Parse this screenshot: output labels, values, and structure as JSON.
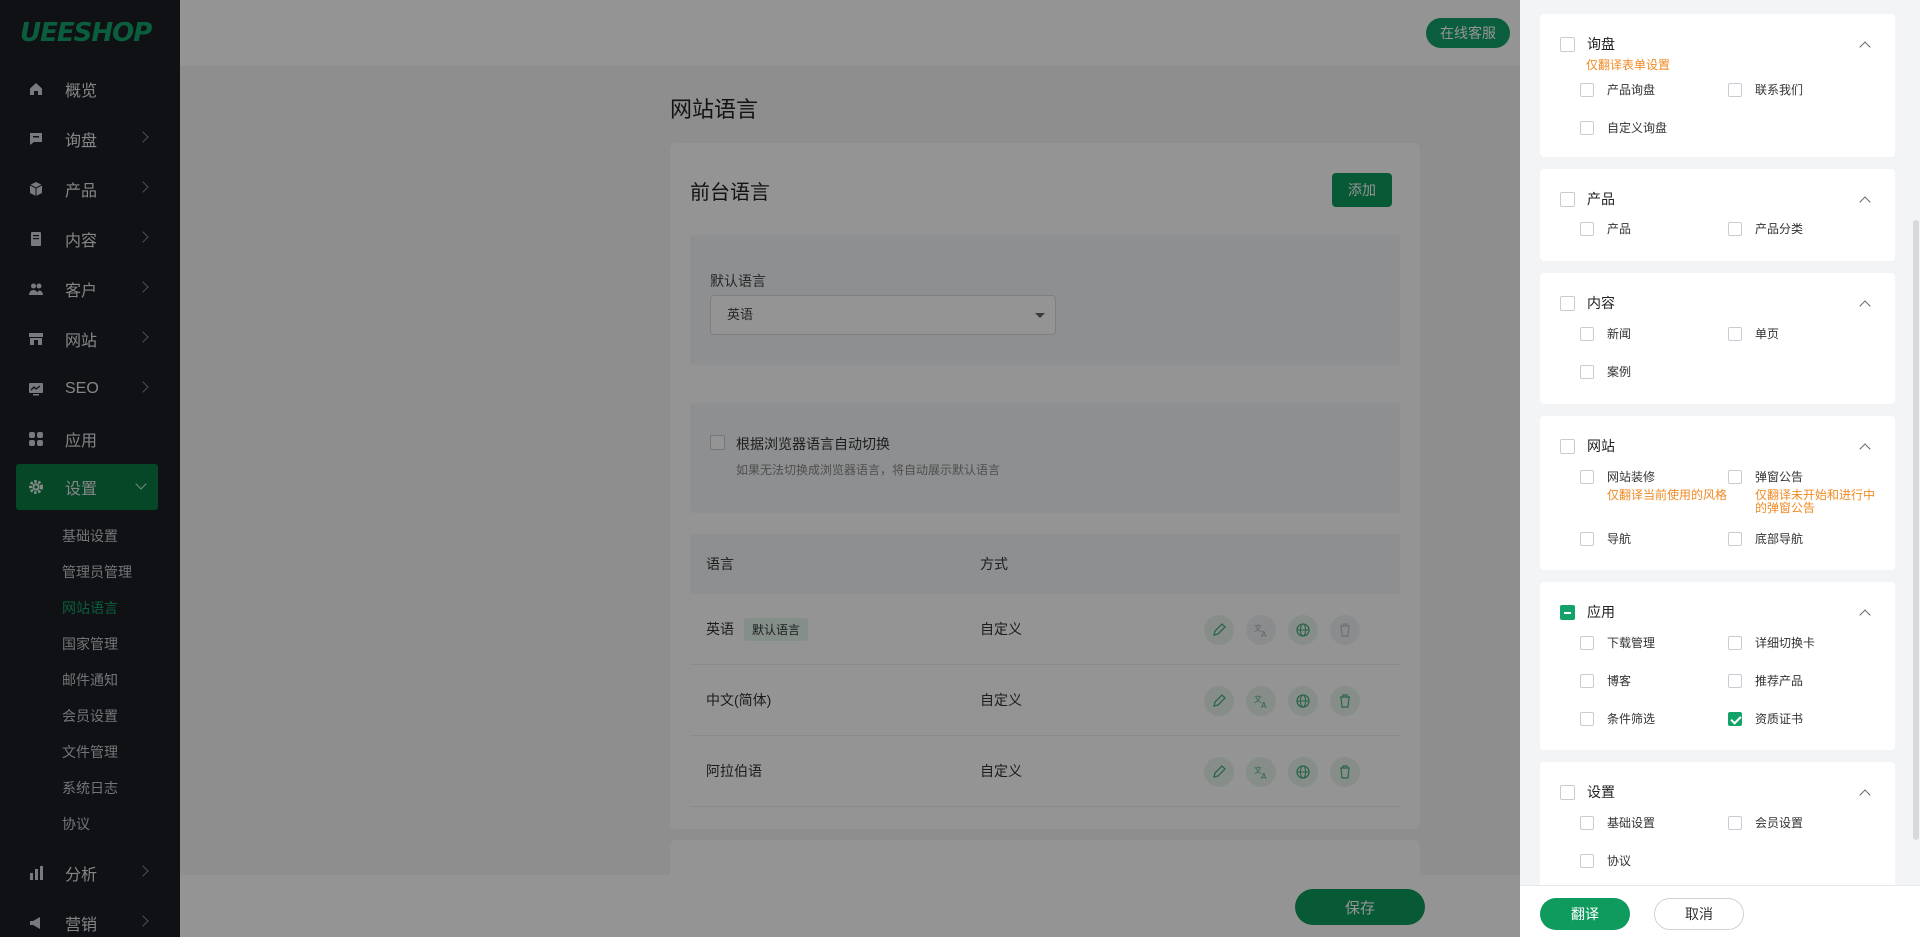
{
  "brand": {
    "logo_text": "UEESHOP"
  },
  "sidebar": {
    "items": [
      {
        "label": "概览",
        "icon": "home-icon"
      },
      {
        "label": "询盘",
        "icon": "message-icon"
      },
      {
        "label": "产品",
        "icon": "box-icon"
      },
      {
        "label": "内容",
        "icon": "document-icon"
      },
      {
        "label": "客户",
        "icon": "users-icon"
      },
      {
        "label": "网站",
        "icon": "store-icon"
      },
      {
        "label": "SEO",
        "icon": "monitor-icon"
      },
      {
        "label": "应用",
        "icon": "apps-icon"
      },
      {
        "label": "设置",
        "icon": "gear-icon"
      }
    ],
    "settings_sub": [
      "基础设置",
      "管理员管理",
      "网站语言",
      "国家管理",
      "邮件通知",
      "会员设置",
      "文件管理",
      "系统日志",
      "协议"
    ],
    "after": [
      {
        "label": "分析",
        "icon": "bar-chart-icon"
      },
      {
        "label": "营销",
        "icon": "megaphone-icon"
      }
    ]
  },
  "header": {
    "support_button": "在线客服"
  },
  "main": {
    "page_title": "网站语言",
    "frontend_title": "前台语言",
    "add_button": "添加",
    "default_language_label": "默认语言",
    "default_language_value": "英语",
    "auto_switch_label": "根据浏览器语言自动切换",
    "auto_switch_note": "如果无法切换成浏览器语言，将自动展示默认语言",
    "table": {
      "headers": [
        "语言",
        "方式"
      ],
      "rows": [
        {
          "lang": "英语",
          "tag": "默认语言",
          "method": "自定义"
        },
        {
          "lang": "中文(简体)",
          "tag": "",
          "method": "自定义"
        },
        {
          "lang": "阿拉伯语",
          "tag": "",
          "method": "自定义"
        }
      ]
    },
    "save_button": "保存"
  },
  "drawer": {
    "groups": [
      {
        "title": "询盘",
        "note": "仅翻译表单设置",
        "state": "unchecked",
        "options": [
          {
            "label": "产品询盘",
            "checked": false
          },
          {
            "label": "联系我们",
            "checked": false
          },
          {
            "label": "自定义询盘",
            "checked": false
          }
        ]
      },
      {
        "title": "产品",
        "state": "unchecked",
        "options": [
          {
            "label": "产品",
            "checked": false
          },
          {
            "label": "产品分类",
            "checked": false
          }
        ]
      },
      {
        "title": "内容",
        "state": "unchecked",
        "options": [
          {
            "label": "新闻",
            "checked": false
          },
          {
            "label": "单页",
            "checked": false
          },
          {
            "label": "案例",
            "checked": false
          }
        ]
      },
      {
        "title": "网站",
        "state": "unchecked",
        "options": [
          {
            "label": "网站装修",
            "note": "仅翻译当前使用的风格",
            "checked": false
          },
          {
            "label": "弹窗公告",
            "note": "仅翻译未开始和进行中的弹窗公告",
            "checked": false
          },
          {
            "label": "导航",
            "checked": false
          },
          {
            "label": "底部导航",
            "checked": false
          }
        ]
      },
      {
        "title": "应用",
        "state": "partial",
        "options": [
          {
            "label": "下载管理",
            "checked": false
          },
          {
            "label": "详细切换卡",
            "checked": false
          },
          {
            "label": "博客",
            "checked": false
          },
          {
            "label": "推荐产品",
            "checked": false
          },
          {
            "label": "条件筛选",
            "checked": false
          },
          {
            "label": "资质证书",
            "checked": true
          }
        ]
      },
      {
        "title": "设置",
        "state": "unchecked",
        "options": [
          {
            "label": "基础设置",
            "checked": false
          },
          {
            "label": "会员设置",
            "checked": false
          },
          {
            "label": "协议",
            "checked": false
          }
        ]
      }
    ],
    "translate_button": "翻译",
    "cancel_button": "取消"
  },
  "colors": {
    "brand_green": "#13a26a",
    "button_green": "#0f9a5e",
    "note_orange": "#f08a24",
    "sidebar_bg": "#1b1e24"
  }
}
